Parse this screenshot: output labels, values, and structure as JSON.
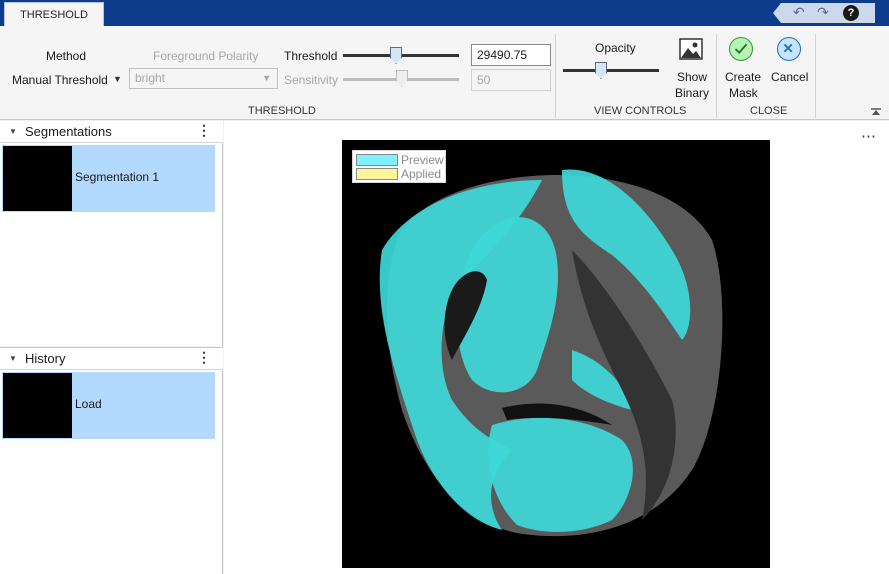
{
  "tabs": {
    "active": "THRESHOLD"
  },
  "quick_access": {
    "undo_icon": "undo-icon",
    "redo_icon": "redo-icon",
    "help": "?"
  },
  "toolstrip": {
    "threshold_section": {
      "title": "THRESHOLD",
      "method_label": "Method",
      "method_value": "Manual Threshold",
      "foreground_polarity_label": "Foreground Polarity",
      "foreground_polarity_value": "bright",
      "threshold_label": "Threshold",
      "threshold_value": "29490.75",
      "threshold_slider_fraction": 0.45,
      "sensitivity_label": "Sensitivity",
      "sensitivity_value": "50",
      "sensitivity_slider_fraction": 0.5
    },
    "view_controls": {
      "title": "VIEW CONTROLS",
      "opacity_label": "Opacity",
      "opacity_slider_fraction": 0.4,
      "show_binary_line1": "Show",
      "show_binary_line2": "Binary"
    },
    "close_section": {
      "title": "CLOSE",
      "create_mask_line1": "Create",
      "create_mask_line2": "Mask",
      "cancel_label": "Cancel"
    }
  },
  "segmentations_pane": {
    "title": "Segmentations",
    "items": [
      {
        "label": "Segmentation 1"
      }
    ]
  },
  "history_pane": {
    "title": "History",
    "items": [
      {
        "label": "Load"
      }
    ]
  },
  "viewer": {
    "legend": [
      {
        "label": "Preview",
        "color": "#7ff0ff"
      },
      {
        "label": "Applied",
        "color": "#fff499"
      }
    ],
    "overlay_color": "#3ed8d8"
  }
}
